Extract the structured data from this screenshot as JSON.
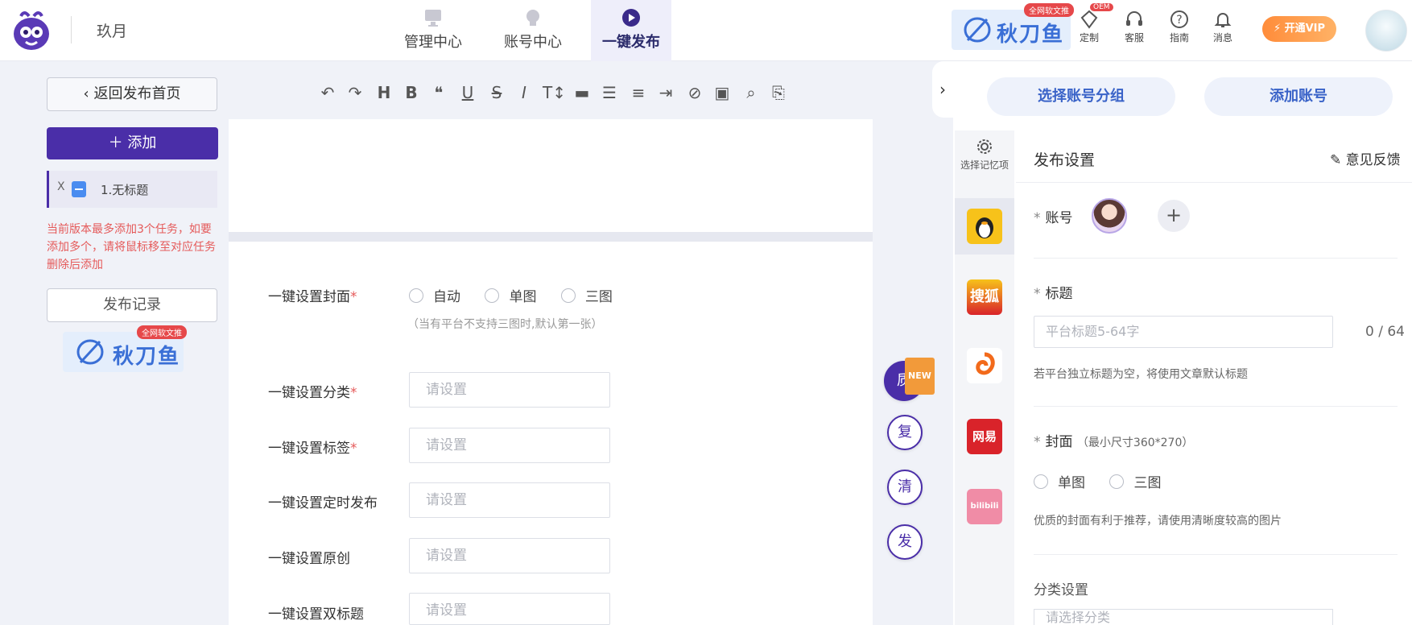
{
  "brand": {
    "name": "玖月"
  },
  "nav": {
    "items": [
      {
        "label": "管理中心"
      },
      {
        "label": "账号中心"
      },
      {
        "label": "一键发布"
      }
    ]
  },
  "promo": {
    "text": "秋刀鱼",
    "tag": "全网软文推",
    "tag_color": "#e6484a"
  },
  "tools": {
    "customize": "定制",
    "customize_tag": "OEM",
    "service": "客服",
    "guide": "指南",
    "messages": "消息",
    "vip": "开通VIP"
  },
  "sidebar": {
    "back": "返回发布首页",
    "add": "添加",
    "task_close": "X",
    "task_title": "1.无标题",
    "warning": "当前版本最多添加3个任务，如要添加多个，请将鼠标移至对应任务删除后添加",
    "record": "发布记录"
  },
  "form": {
    "cover_label": "一键设置封面",
    "cover_options": [
      "自动",
      "单图",
      "三图"
    ],
    "cover_hint": "（当有平台不支持三图时,默认第一张）",
    "category_label": "一键设置分类",
    "tags_label": "一键设置标签",
    "schedule_label": "一键设置定时发布",
    "original_label": "一键设置原创",
    "dual_title_label": "一键设置双标题",
    "placeholder": "请设置",
    "required_mark": "*"
  },
  "fabs": {
    "quality": "质",
    "new_tag": "NEW",
    "copy": "复",
    "clear": "清",
    "publish": "发"
  },
  "right": {
    "select_group": "选择账号分组",
    "add_account": "添加账号",
    "memory_settings": "选择记忆项",
    "section_title": "发布设置",
    "feedback": "意见反馈",
    "account_label": "账号",
    "title_label": "标题",
    "title_placeholder": "平台标题5-64字",
    "title_counter": "0 / 64",
    "title_hint": "若平台独立标题为空，将使用文章默认标题",
    "cover_label": "封面",
    "cover_size": "（最小尺寸360*270）",
    "cover_options": [
      "单图",
      "三图"
    ],
    "cover_hint": "优质的封面有利于推荐，请使用清晰度较高的图片",
    "category_label": "分类设置",
    "category_placeholder": "请选择分类",
    "star": "*"
  },
  "platforms": [
    {
      "icon": "qq-penguin-icon",
      "color": "#f7c21a"
    },
    {
      "icon": "sohu-icon",
      "label": "搜狐",
      "color": "#f1a21a"
    },
    {
      "icon": "dayu-icon",
      "color": "#f26a1b"
    },
    {
      "icon": "netease-icon",
      "label": "网易",
      "color": "#d9232a"
    },
    {
      "icon": "bilibili-icon",
      "label": "bilibili",
      "color": "#f08ca6"
    }
  ],
  "colors": {
    "accent": "#4a2ea8",
    "link": "#3a63c8",
    "warning": "#e55a5a"
  }
}
